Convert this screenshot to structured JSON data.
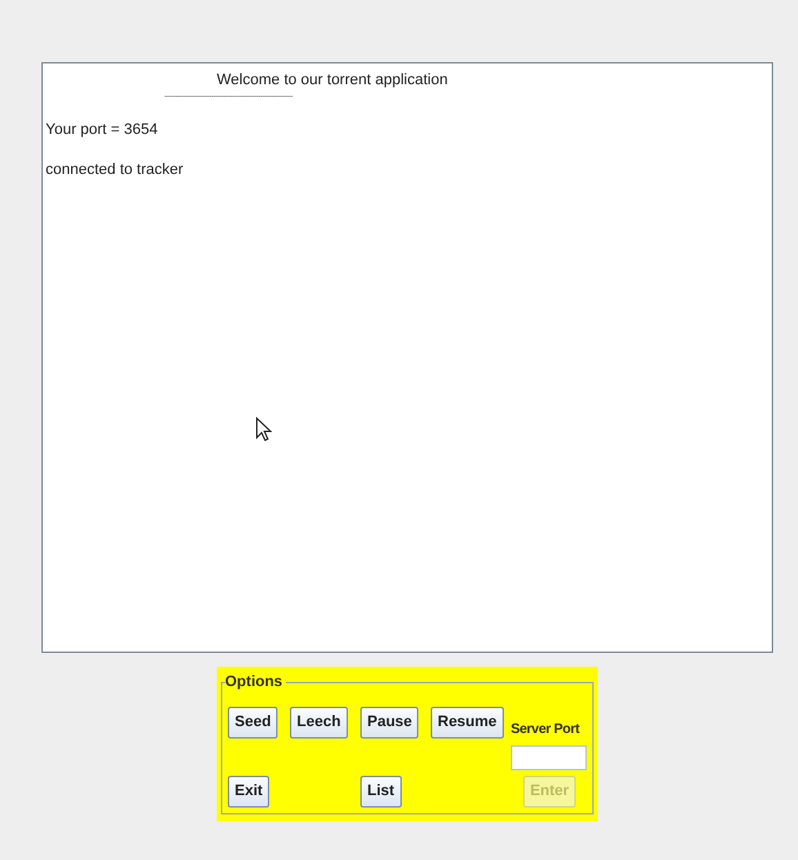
{
  "console": {
    "heading": "Welcome to our torrent application",
    "rule": "--------------------------------------------------------------------",
    "lines": [
      "Your port = 3654",
      "connected to tracker"
    ]
  },
  "options": {
    "legend": "Options",
    "top_buttons": [
      {
        "label": "Seed",
        "disabled": false
      },
      {
        "label": "Leech",
        "disabled": false
      },
      {
        "label": "Pause",
        "disabled": false
      },
      {
        "label": "Resume",
        "disabled": false
      }
    ],
    "server_port": {
      "label": "Server Port"
    },
    "bottom_buttons": [
      {
        "label": "Exit",
        "disabled": false
      },
      {
        "label": "List",
        "disabled": false
      },
      {
        "label": "Enter",
        "disabled": true
      }
    ]
  }
}
